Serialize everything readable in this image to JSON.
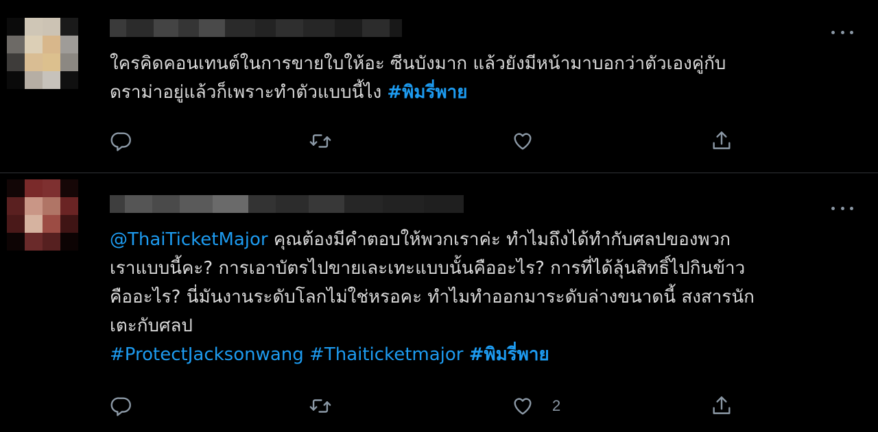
{
  "colors": {
    "background": "#000000",
    "text": "#d9d9d9",
    "link": "#1d9bf0",
    "icon": "#8b98a5",
    "divider": "#2f3336"
  },
  "icons": {
    "reply": "reply-icon",
    "retweet": "retweet-icon",
    "like": "heart-icon",
    "share": "share-icon",
    "more": "more-icon"
  },
  "tweets": [
    {
      "text_line_1": "ใครคิดคอนเทนต์ในการขายใบให้อะ ซีนบังมาก แล้วยังมีหน้ามาบอกว่าตัวเองคู่กับ",
      "text_line_2": "ดราม่าอยู่แล้วก็เพราะทำตัวแบบนี้ไง ",
      "hashtag": "#พิมรี่พาย",
      "like_count": ""
    },
    {
      "mention": "@ThaiTicketMajor",
      "text_line_1": " คุณต้องมีคำตอบให้พวกเราค่ะ ทำไมถึงได้ทำกับศลปของพวก",
      "text_line_2": "เราแบบนี้คะ? การเอาบัตรไปขายเละเทะแบบนั้นคืออะไร? การที่ได้ลุ้นสิทธิ์ไปกินข้าว",
      "text_line_3": "คืออะไร? นี่มันงานระดับโลกไม่ใช่หรอคะ ทำไมทำออกมาระดับล่างขนาดนี้ สงสารนัก",
      "text_line_4": "เตะกับศลป",
      "hashtag_1": "#ProtectJacksonwang",
      "hashtag_2": "#Thaiticketmajor",
      "hashtag_3": "#พิมรี่พาย",
      "like_count": "2"
    }
  ]
}
